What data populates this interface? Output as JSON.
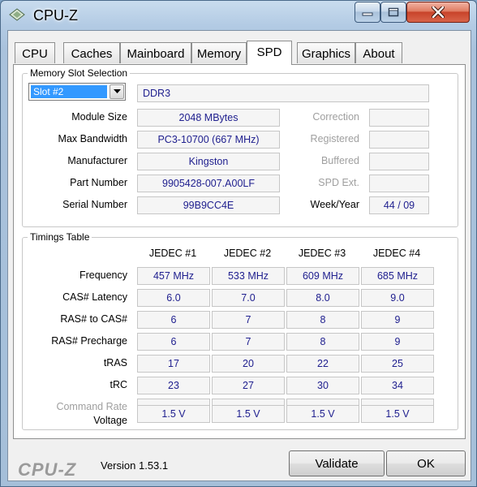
{
  "window": {
    "title": "CPU-Z"
  },
  "tabs": [
    {
      "label": "CPU"
    },
    {
      "label": "Caches"
    },
    {
      "label": "Mainboard"
    },
    {
      "label": "Memory"
    },
    {
      "label": "SPD"
    },
    {
      "label": "Graphics"
    },
    {
      "label": "About"
    }
  ],
  "active_tab": "SPD",
  "slot": {
    "group_label": "Memory Slot Selection",
    "selected": "Slot #2",
    "type": "DDR3",
    "module_size_label": "Module Size",
    "module_size": "2048 MBytes",
    "max_bandwidth_label": "Max Bandwidth",
    "max_bandwidth": "PC3-10700 (667 MHz)",
    "manufacturer_label": "Manufacturer",
    "manufacturer": "Kingston",
    "part_number_label": "Part Number",
    "part_number": "9905428-007.A00LF",
    "serial_number_label": "Serial Number",
    "serial_number": "99B9CC4E",
    "correction_label": "Correction",
    "correction": "",
    "registered_label": "Registered",
    "registered": "",
    "buffered_label": "Buffered",
    "buffered": "",
    "spd_ext_label": "SPD Ext.",
    "spd_ext": "",
    "week_year_label": "Week/Year",
    "week_year": "44 / 09"
  },
  "timings": {
    "group_label": "Timings Table",
    "columns": [
      "JEDEC #1",
      "JEDEC #2",
      "JEDEC #3",
      "JEDEC #4"
    ],
    "rows": [
      {
        "label": "Frequency",
        "values": [
          "457 MHz",
          "533 MHz",
          "609 MHz",
          "685 MHz"
        ]
      },
      {
        "label": "CAS# Latency",
        "values": [
          "6.0",
          "7.0",
          "8.0",
          "9.0"
        ]
      },
      {
        "label": "RAS# to CAS#",
        "values": [
          "6",
          "7",
          "8",
          "9"
        ]
      },
      {
        "label": "RAS# Precharge",
        "values": [
          "6",
          "7",
          "8",
          "9"
        ]
      },
      {
        "label": "tRAS",
        "values": [
          "17",
          "20",
          "22",
          "25"
        ]
      },
      {
        "label": "tRC",
        "values": [
          "23",
          "27",
          "30",
          "34"
        ]
      },
      {
        "label": "Command Rate",
        "values": [
          "",
          "",
          "",
          ""
        ]
      },
      {
        "label": "Voltage",
        "values": [
          "1.5 V",
          "1.5 V",
          "1.5 V",
          "1.5 V"
        ]
      }
    ]
  },
  "footer": {
    "logo": "CPU-Z",
    "version": "Version 1.53.1",
    "validate_label": "Validate",
    "ok_label": "OK"
  },
  "icons": {
    "app": "cpu-z-diamond-icon",
    "minimize": "minimize-icon",
    "maximize": "maximize-icon",
    "close": "close-icon",
    "dropdown": "chevron-down-icon"
  }
}
